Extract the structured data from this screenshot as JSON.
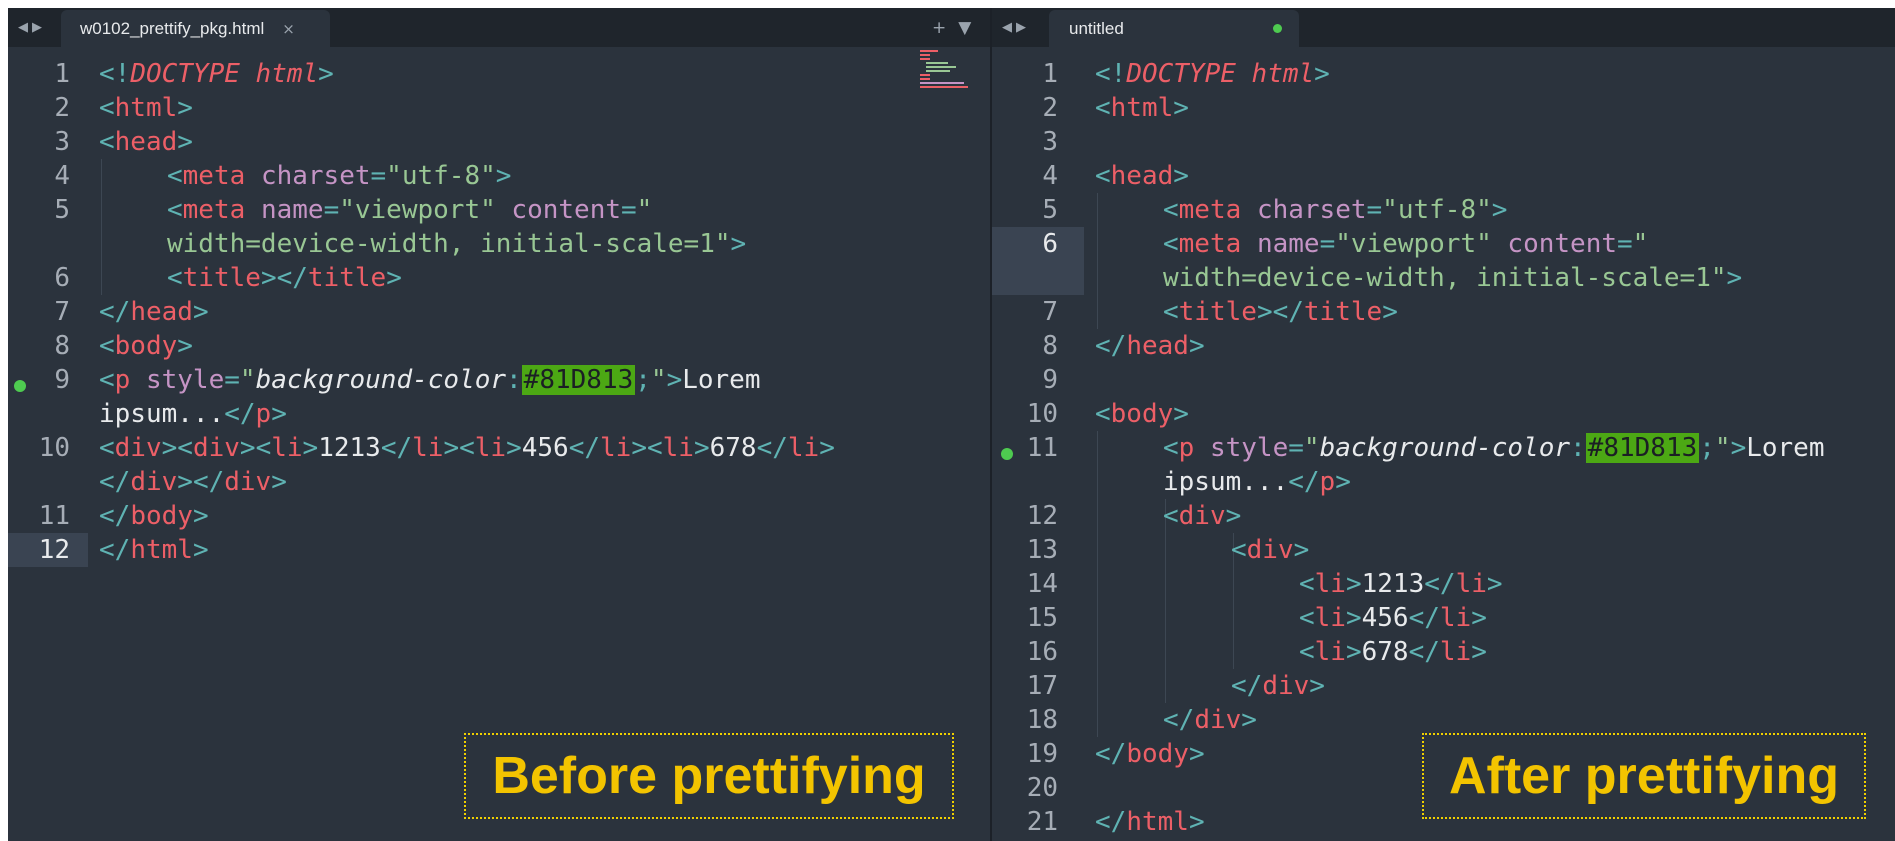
{
  "left_pane": {
    "tab_title": "w0102_prettify_pkg.html",
    "close_glyph": "×",
    "nav_back_glyph": "◀",
    "nav_forward_glyph": "▶",
    "new_tab_glyph": "+",
    "tab_menu_glyph": "▼",
    "line_numbers": [
      "1",
      "2",
      "3",
      "4",
      "5",
      "6",
      "7",
      "8",
      "9",
      "10",
      "11",
      "12"
    ],
    "caption": "Before prettifying"
  },
  "right_pane": {
    "tab_title": "untitled",
    "nav_back_glyph": "◀",
    "nav_forward_glyph": "▶",
    "line_numbers": [
      "1",
      "2",
      "3",
      "4",
      "5",
      "6",
      "7",
      "8",
      "9",
      "10",
      "11",
      "12",
      "13",
      "14",
      "15",
      "16",
      "17",
      "18",
      "19",
      "20",
      "21"
    ],
    "caption": "After prettifying"
  },
  "code": {
    "doctype_open": "<!",
    "doctype_kw": "DOCTYPE",
    "doctype_val": "html",
    "lt": "<",
    "gt": ">",
    "lt_slash": "</",
    "eq": "=",
    "colon": ":",
    "semi": ";",
    "quote": "\"",
    "tag_html": "html",
    "tag_head": "head",
    "tag_meta": "meta",
    "tag_title": "title",
    "tag_body": "body",
    "tag_p": "p",
    "tag_div": "div",
    "tag_li": "li",
    "attr_charset": "charset",
    "attr_name": "name",
    "attr_content": "content",
    "attr_style": "style",
    "val_utf8": "\"utf-8\"",
    "val_viewport": "\"viewport\"",
    "val_content_open": "\"",
    "val_content_rest": "width=device-width, initial-scale=1\"",
    "css_prop": "background-color",
    "css_hex": "#81D813",
    "text_lorem": "Lorem",
    "text_ipsum": "ipsum...",
    "li_1": "1213",
    "li_2": "456",
    "li_3": "678"
  },
  "colors": {
    "editor_bg": "#2b333d",
    "tabbar_bg": "#1f252c",
    "tag": "#ec5f67",
    "punctuation": "#5fb3b3",
    "attribute": "#c594c5",
    "string": "#99c794",
    "text": "#e8eaec",
    "hex_highlight": "#4ca814",
    "caption": "#f3c400"
  }
}
